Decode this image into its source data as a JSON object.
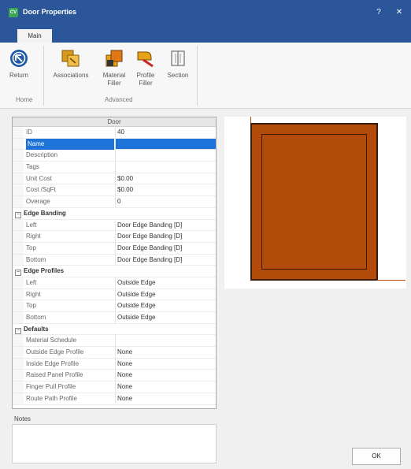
{
  "window": {
    "title": "Door Properties",
    "app_icon_text": "CV",
    "help_label": "?",
    "close_label": "✕"
  },
  "tabs": [
    {
      "label": "Main"
    }
  ],
  "ribbon": {
    "buttons": {
      "return": "Return",
      "associations": "Associations",
      "material_filler": "Material Filler",
      "profile_filler": "Profile Filler",
      "section": "Section"
    },
    "groups": {
      "home": "Home",
      "advanced": "Advanced"
    }
  },
  "grid": {
    "header": "Door",
    "rows": [
      {
        "key": "ID",
        "value": "40"
      },
      {
        "key": "Name",
        "value": ""
      },
      {
        "key": "Description",
        "value": ""
      },
      {
        "key": "Tags",
        "value": ""
      },
      {
        "key": "Unit Cost",
        "value": "$0.00"
      },
      {
        "key": "Cost /SqFt",
        "value": "$0.00"
      },
      {
        "key": "Overage",
        "value": "0"
      },
      {
        "category": "Edge Banding"
      },
      {
        "key": "Left",
        "value": "Door Edge Banding [D]"
      },
      {
        "key": "Right",
        "value": "Door Edge Banding [D]"
      },
      {
        "key": "Top",
        "value": "Door Edge Banding [D]"
      },
      {
        "key": "Bottom",
        "value": "Door Edge Banding [D]"
      },
      {
        "category": "Edge Profiles"
      },
      {
        "key": "Left",
        "value": "Outside Edge"
      },
      {
        "key": "Right",
        "value": "Outside Edge"
      },
      {
        "key": "Top",
        "value": "Outside Edge"
      },
      {
        "key": "Bottom",
        "value": "Outside Edge"
      },
      {
        "category": "Defaults"
      },
      {
        "key": "Material Schedule",
        "value": ""
      },
      {
        "key": "Outside Edge Profile",
        "value": "None"
      },
      {
        "key": "Inside Edge Profile",
        "value": "None"
      },
      {
        "key": "Raised Panel Profile",
        "value": "None"
      },
      {
        "key": "Finger Pull Profile",
        "value": "None"
      },
      {
        "key": "Route Path Profile",
        "value": "None"
      }
    ],
    "selected_row": "Name"
  },
  "notes": {
    "label": "Notes",
    "value": ""
  },
  "ok_label": "OK",
  "colors": {
    "titlebar": "#2b579a",
    "door": "#b24a0a",
    "selection": "#1e73d8"
  }
}
